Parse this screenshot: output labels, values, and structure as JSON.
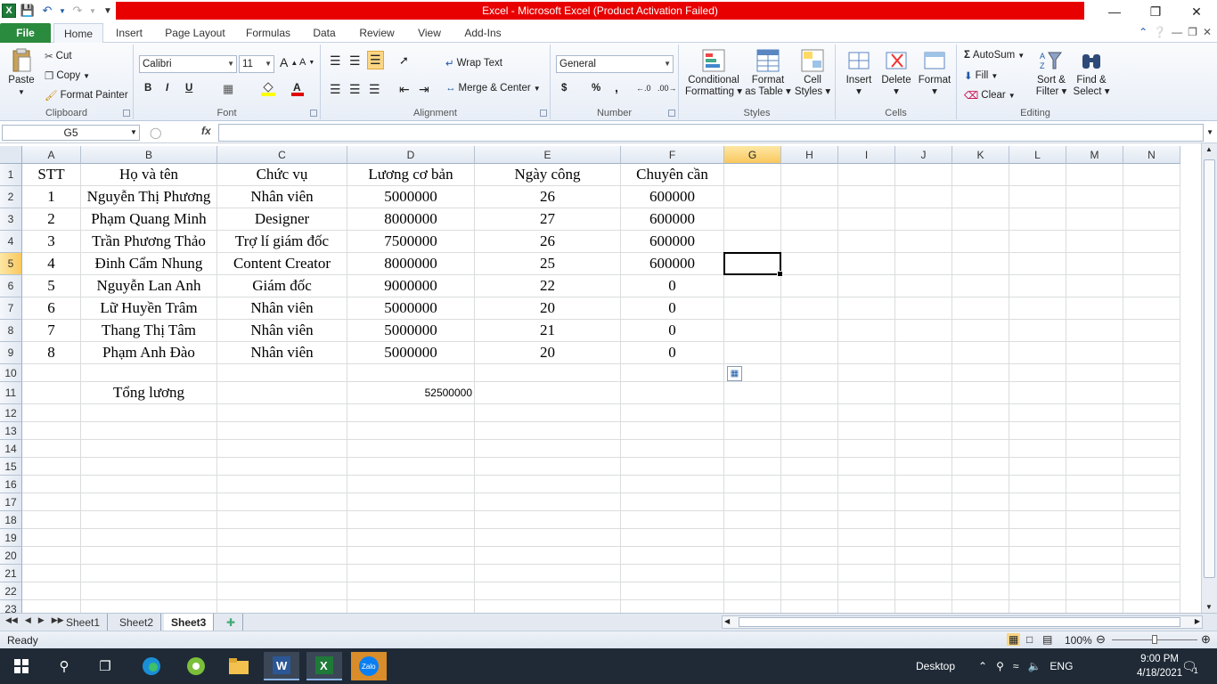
{
  "window": {
    "title": "Excel  -  Microsoft Excel (Product Activation Failed)",
    "title_bg": "#e80000"
  },
  "ribbon_tabs": [
    "File",
    "Home",
    "Insert",
    "Page Layout",
    "Formulas",
    "Data",
    "Review",
    "View",
    "Add-Ins"
  ],
  "clipboard": {
    "paste": "Paste",
    "cut": "Cut",
    "copy": "Copy",
    "format_painter": "Format Painter",
    "label": "Clipboard"
  },
  "font": {
    "name": "Calibri",
    "size": "11",
    "bold": "B",
    "italic": "I",
    "underline": "U",
    "label": "Font"
  },
  "alignment": {
    "wrap_text": "Wrap Text",
    "merge_center": "Merge & Center",
    "label": "Alignment"
  },
  "number": {
    "format": "General",
    "currency": "$",
    "percent": "%",
    "comma": ",",
    "label": "Number"
  },
  "styles": {
    "conditional": "Conditional",
    "formatting": "Formatting",
    "format": "Format",
    "as_table": "as Table",
    "cell": "Cell",
    "styles": "Styles",
    "label": "Styles"
  },
  "cells": {
    "insert": "Insert",
    "delete": "Delete",
    "format": "Format",
    "label": "Cells"
  },
  "editing": {
    "autosum": "AutoSum",
    "fill": "Fill",
    "clear": "Clear",
    "sort": "Sort &",
    "filter": "Filter",
    "find": "Find &",
    "select": "Select",
    "label": "Editing"
  },
  "formula_bar": {
    "name_box": "G5",
    "fx": "fx",
    "value": ""
  },
  "columns": [
    "A",
    "B",
    "C",
    "D",
    "E",
    "F",
    "G",
    "H",
    "I",
    "J",
    "K",
    "L",
    "M",
    "N"
  ],
  "selected_column": "G",
  "rows": [
    "1",
    "2",
    "3",
    "4",
    "5",
    "6",
    "7",
    "8",
    "9",
    "10",
    "11",
    "12",
    "13",
    "14",
    "15",
    "16",
    "17",
    "18",
    "19",
    "20",
    "21",
    "22",
    "23"
  ],
  "selected_row": "5",
  "table": {
    "header": [
      "STT",
      "Họ và tên",
      "Chức vụ",
      "Lương cơ bản",
      "Ngày công",
      "Chuyên cần"
    ],
    "data": [
      [
        "1",
        "Nguyễn Thị Phương",
        "Nhân viên",
        "5000000",
        "26",
        "600000"
      ],
      [
        "2",
        "Phạm Quang Minh",
        "Designer",
        "8000000",
        "27",
        "600000"
      ],
      [
        "3",
        "Trần Phương Thảo",
        "Trợ lí giám đốc",
        "7500000",
        "26",
        "600000"
      ],
      [
        "4",
        "Đinh Cẩm Nhung",
        "Content Creator",
        "8000000",
        "25",
        "600000"
      ],
      [
        "5",
        "Nguyễn Lan Anh",
        "Giám đốc",
        "9000000",
        "22",
        "0"
      ],
      [
        "6",
        "Lữ Huyền Trâm",
        "Nhân viên",
        "5000000",
        "20",
        "0"
      ],
      [
        "7",
        "Thang Thị Tâm",
        "Nhân viên",
        "5000000",
        "21",
        "0"
      ],
      [
        "8",
        "Phạm Anh Đào",
        "Nhân viên",
        "5000000",
        "20",
        "0"
      ]
    ],
    "total_label": "Tổng lương",
    "total_value": "52500000"
  },
  "sheets": [
    "Sheet1",
    "Sheet2",
    "Sheet3"
  ],
  "active_sheet": "Sheet3",
  "status": {
    "ready": "Ready",
    "zoom": "100%"
  },
  "taskbar": {
    "desktop": "Desktop",
    "lang": "ENG",
    "time": "9:00 PM",
    "date": "4/18/2021",
    "notif": "1"
  }
}
